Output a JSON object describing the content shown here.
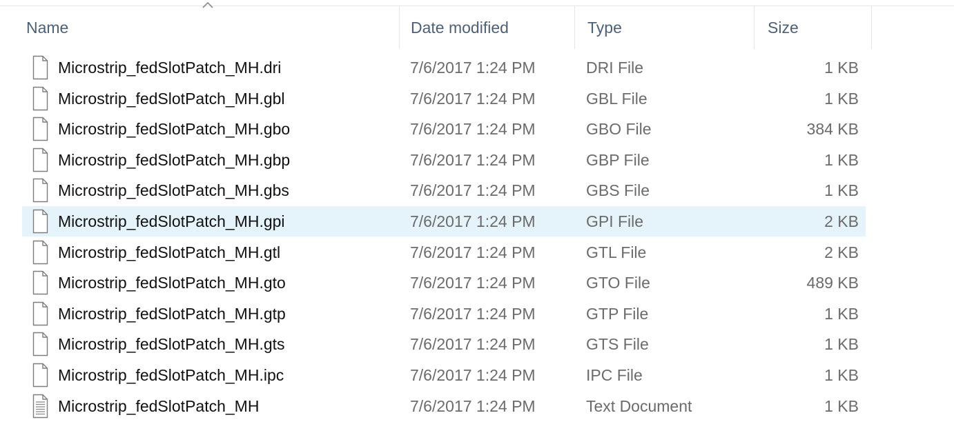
{
  "columns": {
    "name": "Name",
    "date": "Date modified",
    "type": "Type",
    "size": "Size"
  },
  "sort": {
    "column": "name",
    "direction": "ascending",
    "icon": "chevron-up-icon"
  },
  "files": [
    {
      "name": "Microstrip_fedSlotPatch_MH.dri",
      "date": "7/6/2017 1:24 PM",
      "type": "DRI File",
      "size": "1 KB",
      "icon": "generic-file-icon",
      "selected": false
    },
    {
      "name": "Microstrip_fedSlotPatch_MH.gbl",
      "date": "7/6/2017 1:24 PM",
      "type": "GBL File",
      "size": "1 KB",
      "icon": "generic-file-icon",
      "selected": false
    },
    {
      "name": "Microstrip_fedSlotPatch_MH.gbo",
      "date": "7/6/2017 1:24 PM",
      "type": "GBO File",
      "size": "384 KB",
      "icon": "generic-file-icon",
      "selected": false
    },
    {
      "name": "Microstrip_fedSlotPatch_MH.gbp",
      "date": "7/6/2017 1:24 PM",
      "type": "GBP File",
      "size": "1 KB",
      "icon": "generic-file-icon",
      "selected": false
    },
    {
      "name": "Microstrip_fedSlotPatch_MH.gbs",
      "date": "7/6/2017 1:24 PM",
      "type": "GBS File",
      "size": "1 KB",
      "icon": "generic-file-icon",
      "selected": false
    },
    {
      "name": "Microstrip_fedSlotPatch_MH.gpi",
      "date": "7/6/2017 1:24 PM",
      "type": "GPI File",
      "size": "2 KB",
      "icon": "generic-file-icon",
      "selected": true
    },
    {
      "name": "Microstrip_fedSlotPatch_MH.gtl",
      "date": "7/6/2017 1:24 PM",
      "type": "GTL File",
      "size": "2 KB",
      "icon": "generic-file-icon",
      "selected": false
    },
    {
      "name": "Microstrip_fedSlotPatch_MH.gto",
      "date": "7/6/2017 1:24 PM",
      "type": "GTO File",
      "size": "489 KB",
      "icon": "generic-file-icon",
      "selected": false
    },
    {
      "name": "Microstrip_fedSlotPatch_MH.gtp",
      "date": "7/6/2017 1:24 PM",
      "type": "GTP File",
      "size": "1 KB",
      "icon": "generic-file-icon",
      "selected": false
    },
    {
      "name": "Microstrip_fedSlotPatch_MH.gts",
      "date": "7/6/2017 1:24 PM",
      "type": "GTS File",
      "size": "1 KB",
      "icon": "generic-file-icon",
      "selected": false
    },
    {
      "name": "Microstrip_fedSlotPatch_MH.ipc",
      "date": "7/6/2017 1:24 PM",
      "type": "IPC File",
      "size": "1 KB",
      "icon": "generic-file-icon",
      "selected": false
    },
    {
      "name": "Microstrip_fedSlotPatch_MH",
      "date": "7/6/2017 1:24 PM",
      "type": "Text Document",
      "size": "1 KB",
      "icon": "text-document-icon",
      "selected": false
    }
  ],
  "colors": {
    "header_text": "#4c607a",
    "secondary_text": "#6b6b6b",
    "selection_bg": "#e5f3fb"
  }
}
